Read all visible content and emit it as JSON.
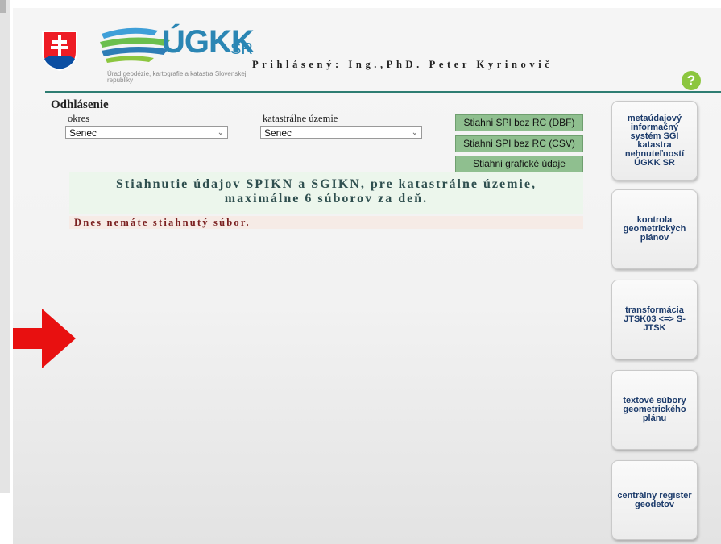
{
  "header": {
    "logo_text": "ÚGKK",
    "logo_suffix": "SR",
    "logo_subtitle": "Úrad geodézie, kartografie a katastra Slovenskej republiky",
    "logged_user": "Prihlásený: Ing.,PhD. Peter Kyrinovič",
    "help_label": "?"
  },
  "main": {
    "logout_label": "Odhlásenie",
    "okres_label": "okres",
    "okres_value": "Senec",
    "ku_label": "katastrálne územie",
    "ku_value": "Senec",
    "buttons": [
      {
        "label": "Stiahni SPI bez RC (DBF)"
      },
      {
        "label": "Stiahni SPI bez RC (CSV)"
      },
      {
        "label": "Stiahni grafické údaje"
      }
    ],
    "info_line1": "Stiahnutie údajov SPIKN a SGIKN, pre katastrálne územie,",
    "info_line2": "maximálne 6 súborov za deň.",
    "status_text": "Dnes nemáte stiahnutý súbor."
  },
  "sidebar": {
    "items": [
      {
        "label": "metaúdajový informačný systém SGI katastra nehnuteľností ÚGKK SR"
      },
      {
        "label": "kontrola geometrických plánov"
      },
      {
        "label": "transformácia JTSK03 <=> S-JTSK"
      },
      {
        "label": "textové súbory geometrického plánu"
      },
      {
        "label": "centrálny register geodetov"
      }
    ]
  },
  "colors": {
    "accent_line": "#2e7d72",
    "button_green": "#8fbf8f",
    "arrow_red": "#e81010",
    "logo_blue": "#2b86b4",
    "status_text": "#7a1f1f"
  },
  "icons": [
    "coat-of-arms-icon",
    "ugkk-logo-icon",
    "help-icon",
    "red-arrow-icon",
    "chevron-down-icon"
  ]
}
